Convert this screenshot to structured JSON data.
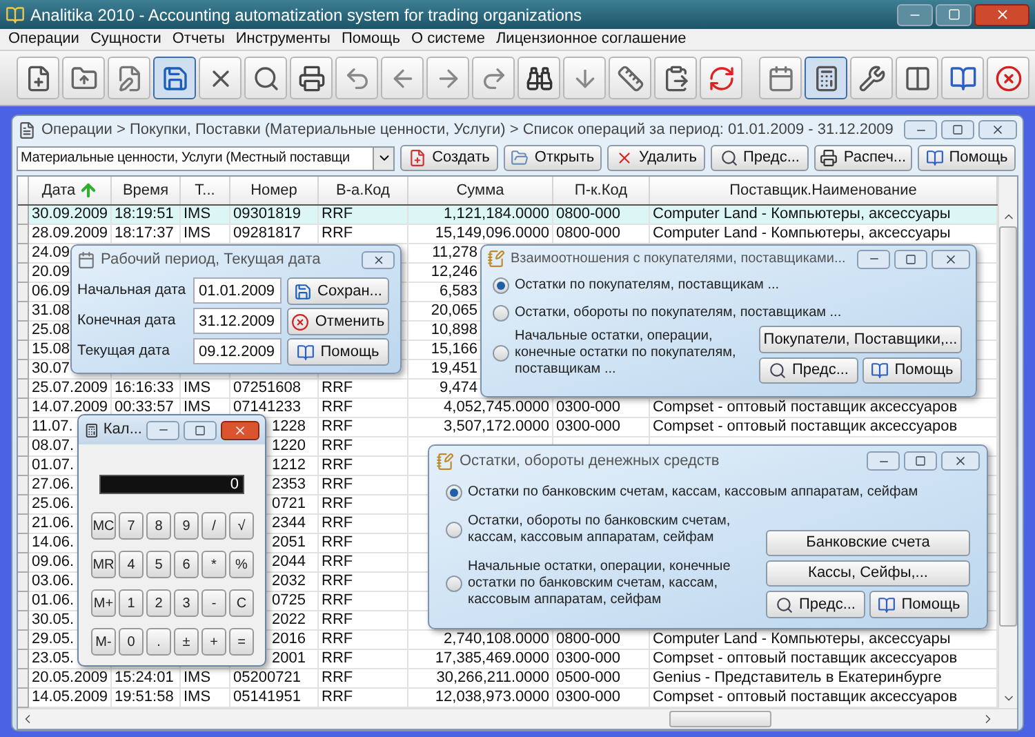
{
  "window": {
    "title": "Analitika 2010 - Accounting automatization system for trading organizations"
  },
  "menu": [
    "Операции",
    "Сущности",
    "Отчеты",
    "Инструменты",
    "Помощь",
    "О системе",
    "Лицензионное соглашение"
  ],
  "toolbar": [
    {
      "kind": "new",
      "pressed": false
    },
    {
      "kind": "open",
      "pressed": false
    },
    {
      "kind": "edit",
      "pressed": false
    },
    {
      "kind": "save",
      "pressed": true
    },
    {
      "kind": "delete",
      "pressed": false
    },
    {
      "kind": "find",
      "pressed": false
    },
    {
      "kind": "print",
      "pressed": false
    },
    {
      "kind": "first",
      "pressed": false
    },
    {
      "kind": "prev",
      "pressed": false
    },
    {
      "kind": "next",
      "pressed": false
    },
    {
      "kind": "last",
      "pressed": false
    },
    {
      "kind": "binoculars",
      "pressed": false
    },
    {
      "kind": "down",
      "pressed": false
    },
    {
      "kind": "ruler",
      "pressed": false
    },
    {
      "kind": "paste",
      "pressed": false
    },
    {
      "kind": "refresh",
      "pressed": false
    },
    {
      "kind": "calendar",
      "pressed": false
    },
    {
      "kind": "calculator",
      "pressed": true
    },
    {
      "kind": "tools",
      "pressed": false
    },
    {
      "kind": "columns",
      "pressed": false
    },
    {
      "kind": "help",
      "pressed": false
    },
    {
      "kind": "exit",
      "pressed": false
    }
  ],
  "document": {
    "breadcrumb": "Операции > Покупки, Поставки (Материальные ценности, Услуги) > Список операций за период: 01.01.2009 - 31.12.2009",
    "filter": {
      "value": "Материальные ценности, Услуги (Местный поставщи"
    },
    "buttons": [
      {
        "label": "Создать",
        "kind": "create"
      },
      {
        "label": "Открыть",
        "kind": "open"
      },
      {
        "label": "Удалить",
        "kind": "delete"
      },
      {
        "label": "Предс...",
        "kind": "preview"
      },
      {
        "label": "Распеч...",
        "kind": "print"
      },
      {
        "label": "Помощь",
        "kind": "help"
      }
    ],
    "table": {
      "columns": [
        {
          "label": "Дата",
          "sorted": true
        },
        {
          "label": "Время",
          "sorted": false
        },
        {
          "label": "Т...",
          "sorted": false
        },
        {
          "label": "Номер",
          "sorted": false
        },
        {
          "label": "В-а.Код",
          "sorted": false
        },
        {
          "label": "Сумма",
          "sorted": false
        },
        {
          "label": "П-к.Код",
          "sorted": false
        },
        {
          "label": "Поставщик.Наименование",
          "sorted": false
        }
      ],
      "rows": [
        {
          "kind": "plain",
          "selected": true,
          "date": "30.09.2009",
          "time": "18:19:51",
          "type": "IMS",
          "number": "09301819",
          "currency": "RRF",
          "amount": "1,121,184.0000",
          "account": "0800-000",
          "supplier": "Computer Land - Компьютеры, аксессуары"
        },
        {
          "kind": "plain",
          "selected": false,
          "date": "28.09.2009",
          "time": "18:17:37",
          "type": "IMS",
          "number": "09281817",
          "currency": "RRF",
          "amount": "15,149,096.0000",
          "account": "0800-000",
          "supplier": "Computer Land - Компьютеры, аксессуары"
        },
        {
          "kind": "amount_cut",
          "selected": false,
          "date": "24.09",
          "amount": "11,278"
        },
        {
          "kind": "amount_cut",
          "selected": false,
          "date": "20.09",
          "amount": "12,246"
        },
        {
          "kind": "amount_cut",
          "selected": false,
          "date": "06.09",
          "amount": "6,583"
        },
        {
          "kind": "amount_cut",
          "selected": false,
          "date": "31.08",
          "amount": "20,065"
        },
        {
          "kind": "amount_cut",
          "selected": false,
          "date": "25.08",
          "amount": "10,898"
        },
        {
          "kind": "amount_cut",
          "selected": false,
          "date": "15.08",
          "amount": "15,166"
        },
        {
          "kind": "amount_cut",
          "selected": false,
          "date": "30.07",
          "amount": "19,451"
        },
        {
          "kind": "amount_cut",
          "selected": false,
          "date": "25.07.2009",
          "time": "16:16:33",
          "type": "IMS",
          "number": "07251608",
          "currency": "RRF",
          "amount": "9,474"
        },
        {
          "kind": "plain",
          "selected": false,
          "date": "14.07.2009",
          "time": "00:33:57",
          "type": "IMS",
          "number": "07141233",
          "currency": "RRF",
          "amount": "4,052,745.0000",
          "account": "0300-000",
          "supplier": "Compset - оптовый поставщик аксессуаров"
        },
        {
          "kind": "number_cut",
          "selected": false,
          "date": "11.07.",
          "number": "1228",
          "currency": "RRF",
          "amount": "3,507,172.0000",
          "account": "0300-000",
          "supplier": "Compset - оптовый поставщик аксессуаров"
        },
        {
          "kind": "number_cut",
          "selected": false,
          "date": "08.07.",
          "number": "1220",
          "currency": "RRF"
        },
        {
          "kind": "number_cut",
          "selected": false,
          "date": "01.07.",
          "number": "1212",
          "currency": "RRF"
        },
        {
          "kind": "number_cut",
          "selected": false,
          "date": "27.06.",
          "number": "2353",
          "currency": "RRF"
        },
        {
          "kind": "number_cut",
          "selected": false,
          "date": "25.06.",
          "number": "0721",
          "currency": "RRF"
        },
        {
          "kind": "number_cut",
          "selected": false,
          "date": "21.06.",
          "number": "2344",
          "currency": "RRF"
        },
        {
          "kind": "number_cut",
          "selected": false,
          "date": "14.06.",
          "number": "2051",
          "currency": "RRF"
        },
        {
          "kind": "number_cut",
          "selected": false,
          "date": "09.06.",
          "number": "2044",
          "currency": "RRF"
        },
        {
          "kind": "number_cut",
          "selected": false,
          "date": "03.06.",
          "number": "2032",
          "currency": "RRF"
        },
        {
          "kind": "number_cut",
          "selected": false,
          "date": "01.06.",
          "number": "0725",
          "currency": "RRF"
        },
        {
          "kind": "number_cut",
          "selected": false,
          "date": "30.05.",
          "number": "2022",
          "currency": "RRF"
        },
        {
          "kind": "number_cut",
          "selected": false,
          "date": "29.05.",
          "number": "2016",
          "currency": "RRF",
          "amount": "2,740,108.0000",
          "account": "0800-000",
          "supplier": "Computer Land - Компьютеры, аксессуары"
        },
        {
          "kind": "number_cut",
          "selected": false,
          "date": "23.05.",
          "number": "2001",
          "currency": "RRF",
          "amount": "17,385,469.0000",
          "account": "0300-000",
          "supplier": "Compset - оптовый поставщик аксессуаров"
        },
        {
          "kind": "plain",
          "selected": false,
          "date": "20.05.2009",
          "time": "15:24:01",
          "type": "IMS",
          "number": "05200721",
          "currency": "RRF",
          "amount": "30,266,211.0000",
          "account": "0500-000",
          "supplier": "Genius - Представитель в Екатеринбурге"
        },
        {
          "kind": "plain",
          "selected": false,
          "date": "14.05.2009",
          "time": "19:51:58",
          "type": "IMS",
          "number": "05141951",
          "currency": "RRF",
          "amount": "12,038,973.0000",
          "account": "0300-000",
          "supplier": "Compset - оптовый поставщик аксессуаров"
        }
      ]
    }
  },
  "period_dialog": {
    "title": "Рабочий период, Текущая дата",
    "fields": [
      {
        "label": "Начальная дата",
        "value": "01.01.2009"
      },
      {
        "label": "Конечная дата",
        "value": "31.12.2009"
      },
      {
        "label": "Текущая дата",
        "value": "09.12.2009"
      }
    ],
    "buttons": [
      {
        "label": "Сохран...",
        "kind": "save"
      },
      {
        "label": "Отменить",
        "kind": "cancel"
      },
      {
        "label": "Помощь",
        "kind": "help"
      }
    ]
  },
  "relations_dialog": {
    "title": "Взаимоотношения с покупателями, поставщиками...",
    "options": [
      {
        "label": "Остатки по покупателям, поставщикам ...",
        "selected": true
      },
      {
        "label": "Остатки, обороты по покупателям, поставщикам ...",
        "selected": false
      },
      {
        "label": "Начальные остатки, операции, конечные остатки по покупателям, поставщикам ...",
        "selected": false
      }
    ],
    "buttons": [
      {
        "label": "Покупатели, Поставщики,...",
        "kind": "text"
      },
      {
        "label": "Предс...",
        "kind": "preview"
      },
      {
        "label": "Помощь",
        "kind": "help"
      }
    ]
  },
  "calculator": {
    "title": "Кал...",
    "display": "0",
    "keys": [
      [
        "MC",
        "7",
        "8",
        "9",
        "/",
        "√"
      ],
      [
        "MR",
        "4",
        "5",
        "6",
        "*",
        "%"
      ],
      [
        "M+",
        "1",
        "2",
        "3",
        "-",
        "C"
      ],
      [
        "M-",
        "0",
        ".",
        "±",
        "+",
        "="
      ]
    ]
  },
  "cash_dialog": {
    "title": "Остатки, обороты денежных средств",
    "options": [
      {
        "label": "Остатки по банковским счетам, кассам, кассовым аппаратам, сейфам",
        "selected": true
      },
      {
        "label": "Остатки, обороты по банковским счетам, кассам, кассовым аппаратам, сейфам",
        "selected": false
      },
      {
        "label": "Начальные остатки, операции, конечные остатки по банковским счетам, кассам, кассовым аппаратам, сейфам",
        "selected": false
      }
    ],
    "buttons": [
      {
        "label": "Банковские счета",
        "kind": "text"
      },
      {
        "label": "Кассы, Сейфы,...",
        "kind": "text"
      },
      {
        "label": "Предс...",
        "kind": "preview"
      },
      {
        "label": "Помощь",
        "kind": "help"
      }
    ]
  }
}
